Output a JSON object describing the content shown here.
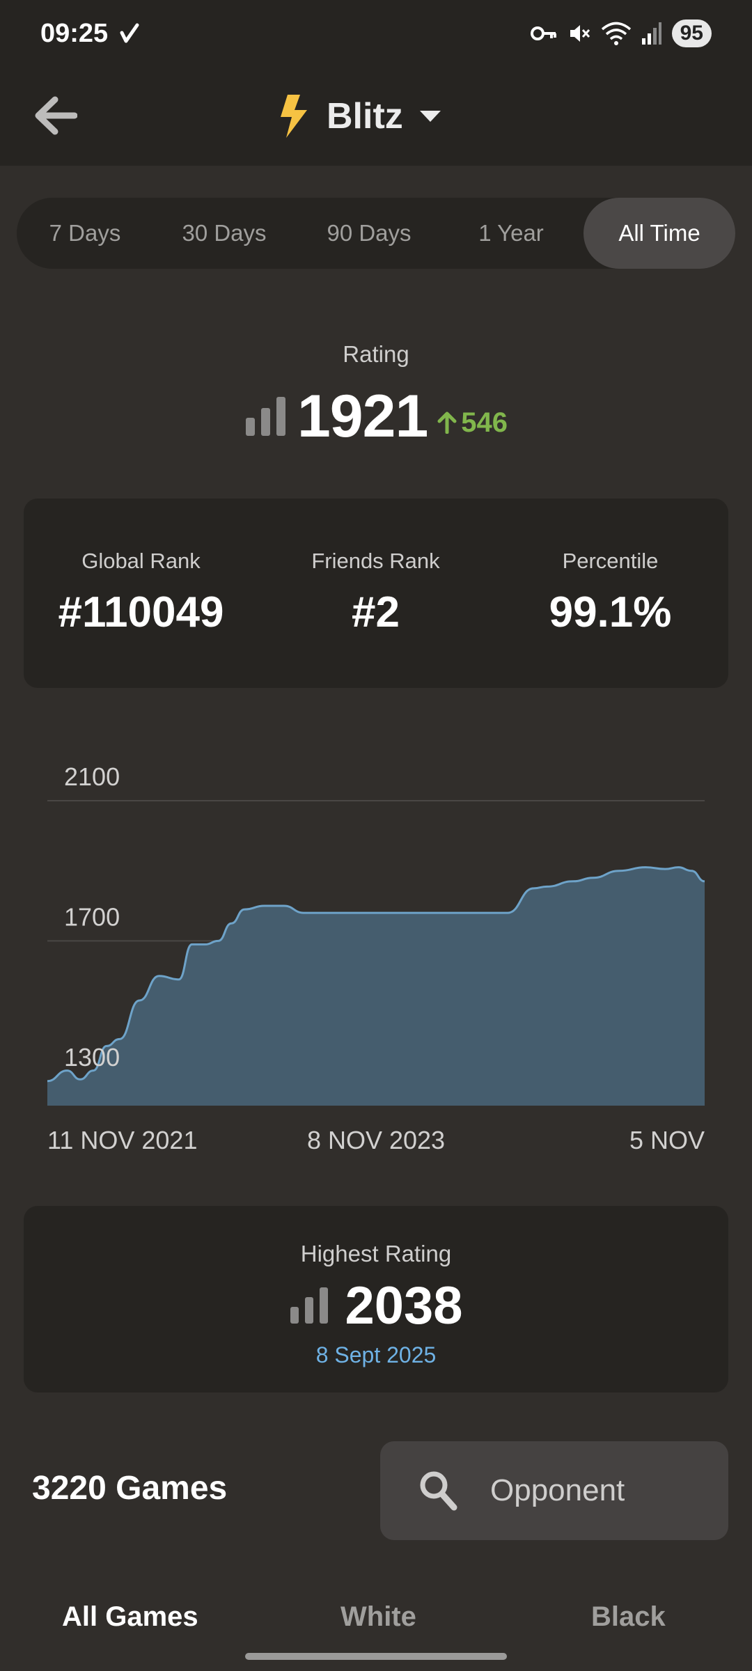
{
  "status_bar": {
    "time": "09:25",
    "battery": "95"
  },
  "header": {
    "title": "Blitz",
    "accent_color": "#f6c243"
  },
  "periods": {
    "items": [
      "7 Days",
      "30 Days",
      "90 Days",
      "1 Year",
      "All Time"
    ],
    "selected": "All Time"
  },
  "rating": {
    "label": "Rating",
    "value": "1921",
    "change": "546",
    "change_color": "#81b64c"
  },
  "ranks": {
    "global_label": "Global Rank",
    "global_value": "#110049",
    "friends_label": "Friends Rank",
    "friends_value": "#2",
    "percentile_label": "Percentile",
    "percentile_value": "99.1%"
  },
  "chart_data": {
    "type": "area",
    "y_ticks": [
      2100,
      1700,
      1300
    ],
    "ylim": [
      1230,
      2100
    ],
    "x_labels": [
      "11 NOV 2021",
      "8 NOV 2023",
      "5 NOV"
    ],
    "x": [
      0,
      0.03,
      0.05,
      0.07,
      0.09,
      0.11,
      0.14,
      0.17,
      0.2,
      0.22,
      0.24,
      0.26,
      0.28,
      0.3,
      0.33,
      0.36,
      0.39,
      0.42,
      0.46,
      0.5,
      0.55,
      0.6,
      0.65,
      0.7,
      0.74,
      0.76,
      0.8,
      0.83,
      0.87,
      0.91,
      0.94,
      0.96,
      0.98,
      1.0
    ],
    "values": [
      1300,
      1330,
      1305,
      1330,
      1400,
      1420,
      1530,
      1600,
      1590,
      1690,
      1690,
      1700,
      1750,
      1790,
      1800,
      1800,
      1780,
      1780,
      1780,
      1780,
      1780,
      1780,
      1780,
      1780,
      1850,
      1855,
      1870,
      1880,
      1900,
      1910,
      1905,
      1910,
      1900,
      1870
    ],
    "fill_color": "#455d6e",
    "line_color": "#6ea3c9",
    "grid": true
  },
  "highest": {
    "label": "Highest Rating",
    "value": "2038",
    "date": "8 Sept 2025"
  },
  "games": {
    "count": "3220 Games",
    "opponent_label": "Opponent"
  },
  "bottom_tabs": {
    "all": "All Games",
    "white": "White",
    "black": "Black"
  }
}
